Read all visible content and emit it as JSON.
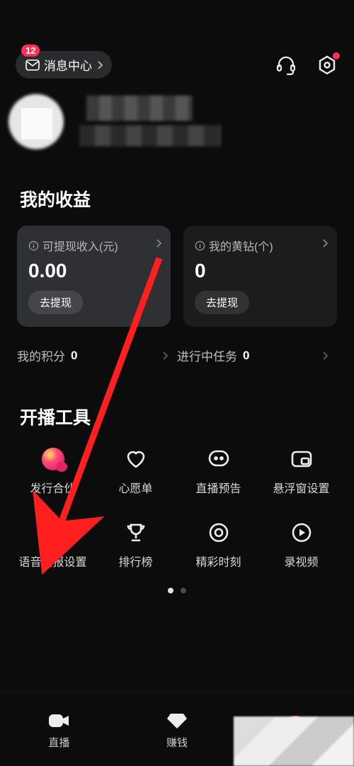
{
  "header": {
    "message_center_label": "消息中心",
    "badge_count": "12"
  },
  "earnings": {
    "section_title": "我的收益",
    "card1": {
      "label": "可提现收入(元)",
      "value": "0.00",
      "button": "去提现"
    },
    "card2": {
      "label": "我的黄钻(个)",
      "value": "0",
      "button": "去提现"
    },
    "stat1": {
      "label": "我的积分",
      "value": "0"
    },
    "stat2": {
      "label": "进行中任务",
      "value": "0"
    }
  },
  "tools": {
    "section_title": "开播工具",
    "items": [
      {
        "label": "发行合伙"
      },
      {
        "label": "心愿单"
      },
      {
        "label": "直播预告"
      },
      {
        "label": "悬浮窗设置"
      },
      {
        "label": "语音播报设置"
      },
      {
        "label": "排行榜"
      },
      {
        "label": "精彩时刻"
      },
      {
        "label": "录视频"
      }
    ]
  },
  "nav": {
    "items": [
      {
        "label": "直播"
      },
      {
        "label": "赚钱"
      },
      {
        "label": ""
      }
    ]
  }
}
